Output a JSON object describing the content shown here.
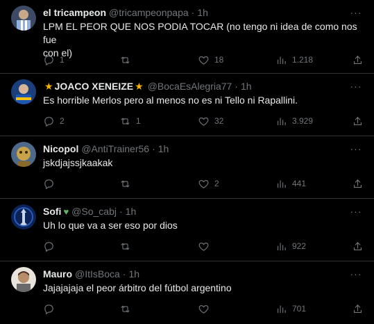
{
  "tweets": [
    {
      "name": "el tricampeon",
      "handle": "@tricampeonpapa",
      "time": "1h",
      "text_lines": [
        "LPM EL PEOR QUE NOS PODIA TOCAR (no tengo ni idea de como nos fue",
        "con el)"
      ],
      "replies": "1",
      "retweets": "",
      "likes": "18",
      "views": "1.218",
      "avatar_color": "#4a5a7a"
    },
    {
      "name": "JOACO XENEIZE",
      "name_prefix": "★",
      "name_suffix": "★",
      "handle": "@BocaEsAlegria77",
      "time": "1h",
      "text_lines": [
        "Es horrible Merlos pero al menos no es ni Tello ni Rapallini."
      ],
      "replies": "2",
      "retweets": "1",
      "likes": "32",
      "views": "3.929",
      "avatar_color": "#1d4f9a"
    },
    {
      "name": "Nicopol",
      "handle": "@AntiTrainer56",
      "time": "1h",
      "text_lines": [
        "jskdjajssjkaakak"
      ],
      "replies": "",
      "retweets": "",
      "likes": "2",
      "views": "441",
      "avatar_color": "#7a6a3a"
    },
    {
      "name": "Sofi",
      "name_suffix_heart": "♥",
      "handle": "@So_cabj",
      "time": "1h",
      "text_lines": [
        "Uh lo que va a ser eso por dios"
      ],
      "replies": "",
      "retweets": "",
      "likes": "",
      "views": "922",
      "avatar_color": "#0d2b6b"
    },
    {
      "name": "Mauro",
      "handle": "@ItIsBoca",
      "time": "1h",
      "text_lines": [
        "Jajajajaja el peor árbitro del fútbol argentino"
      ],
      "replies": "",
      "retweets": "",
      "likes": "",
      "views": "701",
      "avatar_color": "#b08a6a"
    }
  ],
  "separator": "·",
  "more_glyph": "···",
  "colors": {
    "background": "#000000",
    "text": "#e7e9ea",
    "muted": "#71767b",
    "divider": "#2f3336",
    "star": "#f4b400",
    "green_heart": "#5cb85c"
  }
}
